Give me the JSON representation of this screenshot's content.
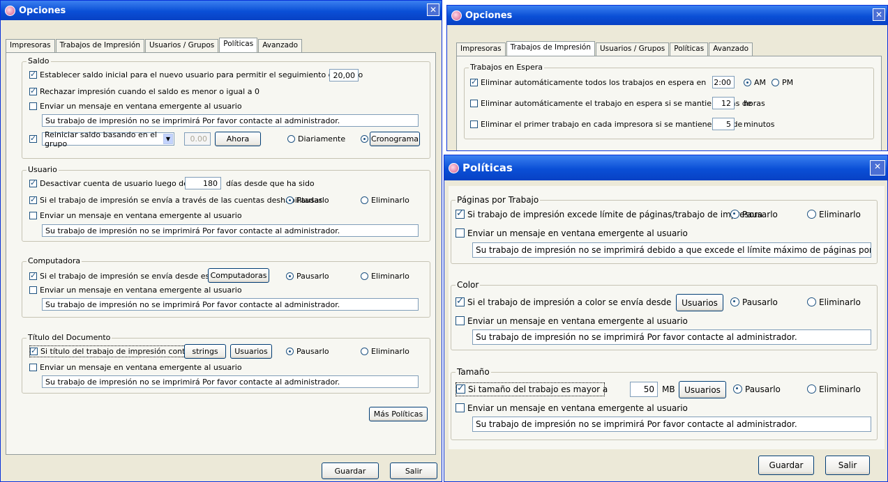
{
  "left": {
    "title": "Opciones",
    "tabs": [
      "Impresoras",
      "Trabajos de Impresión",
      "Usuarios / Grupos",
      "Políticas",
      "Avanzado"
    ],
    "saldo": {
      "legend": "Saldo",
      "establecer": "Establecer saldo inicial para el nuevo usuario para permitir el seguimiento del saldo",
      "establecer_value": "20,00",
      "rechazar": "Rechazar impresión cuando el saldo es menor o igual a 0",
      "enviar": "Enviar un mensaje en ventana emergente al usuario",
      "mensaje": "Su trabajo de impresión no se imprimirá Por favor contacte al administrador.",
      "reiniciar": "Reiniciar saldo basando en el grupo",
      "monto": "0.00",
      "ahora": "Ahora",
      "diariamente": "Diariamente",
      "cronograma": "Cronograma"
    },
    "usuario": {
      "legend": "Usuario",
      "desactivar": "Desactivar cuenta de usuario luego de",
      "dias": "180",
      "dias_suffix": "días desde que ha sido",
      "deshabilitadas": "Si el trabajo de impresión se envía a través de las cuentas deshabilitadas",
      "pausarlo": "Pausarlo",
      "eliminarlo": "Eliminarlo",
      "enviar": "Enviar un mensaje en ventana emergente al usuario",
      "mensaje": "Su trabajo de impresión no se imprimirá Por favor contacte al administrador."
    },
    "computadora": {
      "legend": "Computadora",
      "desde": "Si el trabajo de impresión se envía desde estas",
      "computadoras": "Computadoras",
      "pausarlo": "Pausarlo",
      "eliminarlo": "Eliminarlo",
      "enviar": "Enviar un mensaje en ventana emergente al usuario",
      "mensaje": "Su trabajo de impresión no se imprimirá Por favor contacte al administrador."
    },
    "titulo": {
      "legend": "Título del Documento",
      "contiene": "Si título del trabajo de impresión contiene",
      "strings": "strings",
      "usuarios": "Usuarios",
      "pausarlo": "Pausarlo",
      "eliminarlo": "Eliminarlo",
      "enviar": "Enviar un mensaje en ventana emergente al usuario",
      "mensaje": "Su trabajo de impresión no se imprimirá Por favor contacte al administrador."
    },
    "mas": "Más Políticas",
    "guardar": "Guardar",
    "salir": "Salir"
  },
  "top": {
    "title": "Opciones",
    "tabs": [
      "Impresoras",
      "Trabajos de Impresión",
      "Usuarios / Grupos",
      "Políticas",
      "Avanzado"
    ],
    "legend": "Trabajos en Espera",
    "row1": "Eliminar automáticamente todos los trabajos en espera en",
    "time": "2:00",
    "am": "AM",
    "pm": "PM",
    "row2": "Eliminar automáticamente el trabajo en espera si se mantiene más de",
    "horas_val": "12",
    "horas": "horas",
    "row3": "Eliminar el primer trabajo en cada impresora si se mantiene más de",
    "min_val": "5",
    "minutos": "minutos"
  },
  "right": {
    "title": "Políticas",
    "paginas": {
      "legend": "Páginas por Trabajo",
      "excede": "Si trabajo de impresión excede límite de páginas/trabajo de impresora",
      "pausarlo": "Pausarlo",
      "eliminarlo": "Eliminarlo",
      "enviar": "Enviar un mensaje en ventana emergente al usuario",
      "mensaje": "Su trabajo de impresión no se imprimirá debido a que excede el límite máximo de páginas por trabajo permitido"
    },
    "color": {
      "legend": "Color",
      "desde": "Si el trabajo de impresión a color se envía desde",
      "usuarios": "Usuarios",
      "pausarlo": "Pausarlo",
      "eliminarlo": "Eliminarlo",
      "enviar": "Enviar un mensaje en ventana emergente al usuario",
      "mensaje": "Su trabajo de impresión no se imprimirá Por favor contacte al administrador."
    },
    "tamano": {
      "legend": "Tamaño",
      "mayor": "Si tamaño del trabajo es mayor a",
      "valor": "50",
      "mb": "MB",
      "usuarios": "Usuarios",
      "pausarlo": "Pausarlo",
      "eliminarlo": "Eliminarlo",
      "enviar": "Enviar un mensaje en ventana emergente al usuario",
      "mensaje": "Su trabajo de impresión no se imprimirá Por favor contacte al administrador."
    },
    "guardar": "Guardar",
    "salir": "Salir"
  }
}
